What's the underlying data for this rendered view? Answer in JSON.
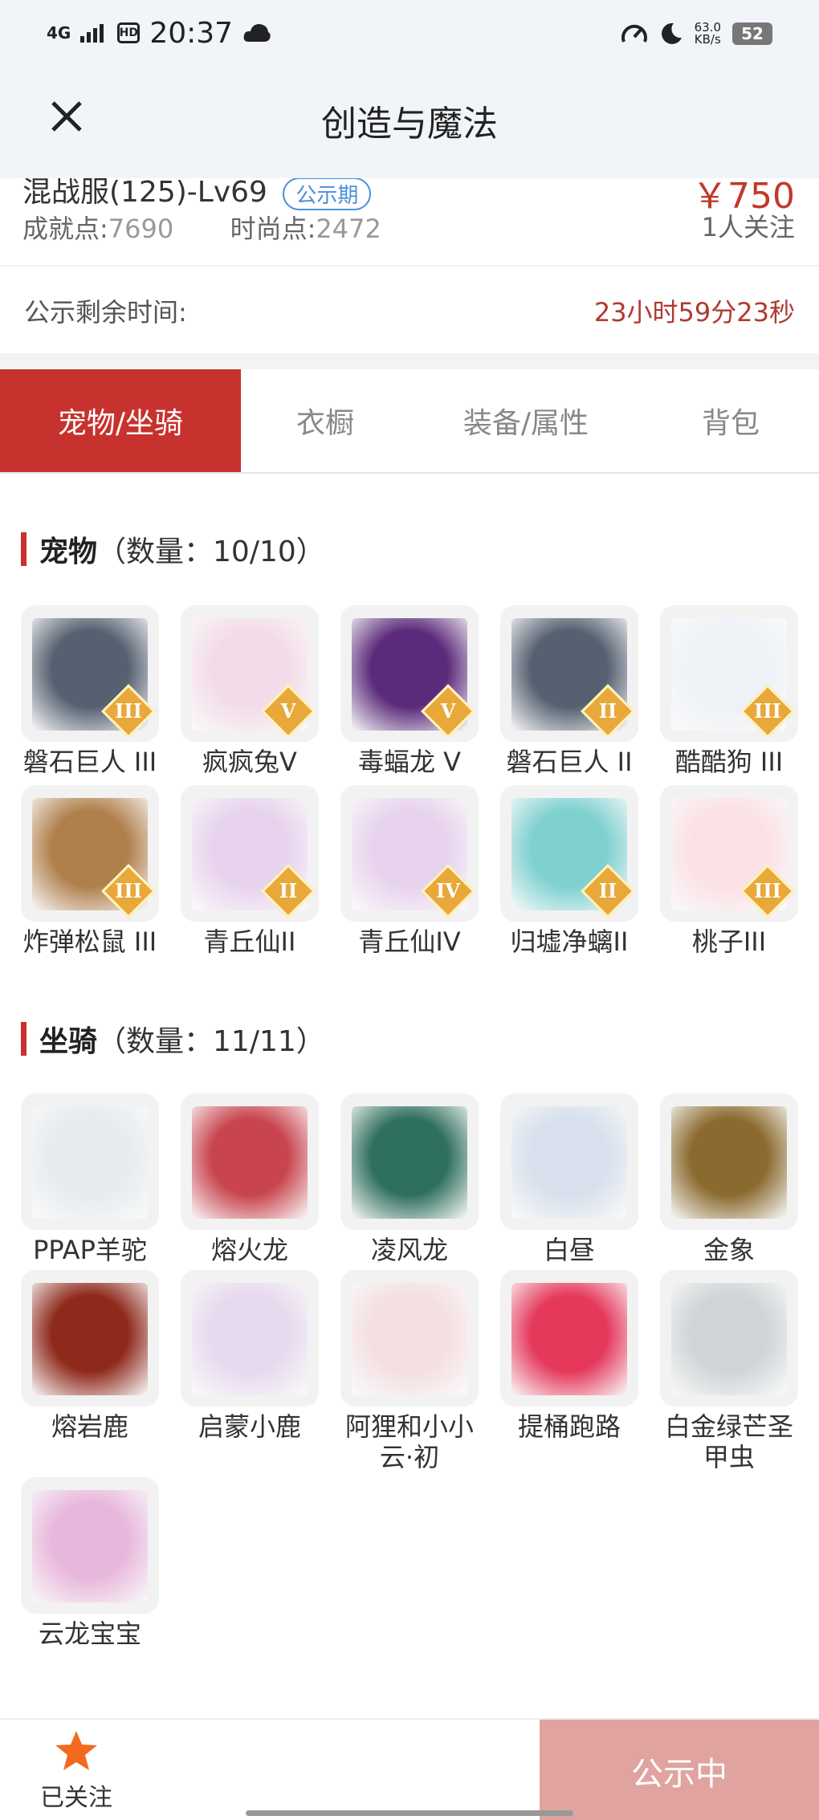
{
  "status": {
    "network": "4G",
    "hd": "HD",
    "time": "20:37",
    "speed_value": "63.0",
    "speed_unit": "KB/s",
    "battery": "52"
  },
  "header": {
    "title": "创造与魔法"
  },
  "summary": {
    "server": "混战服(125)-Lv69",
    "tag": "公示期",
    "price": "￥750",
    "achievement_label": "成就点:",
    "achievement_value": "7690",
    "fashion_label": "时尚点:",
    "fashion_value": "2472",
    "followers": "1人关注"
  },
  "countdown": {
    "label": "公示剩余时间:",
    "value": "23小时59分23秒"
  },
  "tabs": [
    {
      "label": "宠物/坐骑",
      "active": true
    },
    {
      "label": "衣橱",
      "active": false
    },
    {
      "label": "装备/属性",
      "active": false
    },
    {
      "label": "背包",
      "active": false
    }
  ],
  "pets": {
    "title": "宠物",
    "count": "（数量：10/10）",
    "items": [
      {
        "name": "磐石巨人 III",
        "badge": "III",
        "icon": "rock-giant-icon",
        "color": "#556070"
      },
      {
        "name": "疯疯兔V",
        "badge": "V",
        "icon": "rabbit-icon",
        "color": "#f3dce8"
      },
      {
        "name": "毒蝠龙 V",
        "badge": "V",
        "icon": "bat-dragon-icon",
        "color": "#5b2a7a"
      },
      {
        "name": "磐石巨人 II",
        "badge": "II",
        "icon": "rock-giant-icon",
        "color": "#556070"
      },
      {
        "name": "酷酷狗 III",
        "badge": "III",
        "icon": "cool-dog-icon",
        "color": "#eef2f7"
      },
      {
        "name": "炸弹松鼠 III",
        "badge": "III",
        "icon": "squirrel-icon",
        "color": "#b0804c"
      },
      {
        "name": "青丘仙II",
        "badge": "II",
        "icon": "fox-fairy-icon",
        "color": "#e8d3ee"
      },
      {
        "name": "青丘仙IV",
        "badge": "IV",
        "icon": "fox-fairy-icon",
        "color": "#e8d3ee"
      },
      {
        "name": "归墟净螭II",
        "badge": "II",
        "icon": "water-dragon-icon",
        "color": "#7fd1d0"
      },
      {
        "name": "桃子III",
        "badge": "III",
        "icon": "peach-cat-icon",
        "color": "#fbe1e6"
      }
    ]
  },
  "mounts": {
    "title": "坐骑",
    "count": "（数量：11/11）",
    "items": [
      {
        "name": "PPAP羊驼",
        "icon": "alpaca-icon",
        "color": "#e6ebef"
      },
      {
        "name": "熔火龙",
        "icon": "fire-dragon-icon",
        "color": "#c8444e"
      },
      {
        "name": "凌风龙",
        "icon": "wind-dragon-icon",
        "color": "#2f6f5d"
      },
      {
        "name": "白昼",
        "icon": "white-dragon-icon",
        "color": "#d7e0ec"
      },
      {
        "name": "金象",
        "icon": "golden-elephant-icon",
        "color": "#8a6a2e"
      },
      {
        "name": "熔岩鹿",
        "icon": "lava-deer-icon",
        "color": "#8e2a1c"
      },
      {
        "name": "启蒙小鹿",
        "icon": "fawn-icon",
        "color": "#e7d9ee"
      },
      {
        "name": "阿狸和小小云·初",
        "icon": "ali-fox-icon",
        "color": "#f4dfe2"
      },
      {
        "name": "提桶跑路",
        "icon": "bucket-icon",
        "color": "#e5395c"
      },
      {
        "name": "白金绿芒圣甲虫",
        "icon": "scarab-icon",
        "color": "#cfd4d6"
      },
      {
        "name": "云龙宝宝",
        "icon": "cloud-dragon-icon",
        "color": "#e8b8dc"
      }
    ]
  },
  "bottom": {
    "follow_label": "已关注",
    "status_button": "公示中"
  }
}
